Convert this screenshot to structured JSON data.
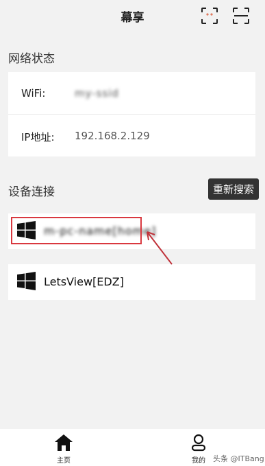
{
  "header": {
    "title": "幕享"
  },
  "network": {
    "section_title": "网络状态",
    "wifi_label": "WiFi:",
    "wifi_value": "my-ssid",
    "ip_label": "IP地址:",
    "ip_value": "192.168.2.129"
  },
  "devices": {
    "section_title": "设备连接",
    "research_label": "重新搜索",
    "items": [
      {
        "name": "m-pc-name[home]"
      },
      {
        "name": "LetsView[EDZ]"
      }
    ]
  },
  "tabbar": {
    "home_label": "主页",
    "mine_label": "我的"
  },
  "watermark": "头条 @ITBang",
  "colors": {
    "highlight": "#d9383f",
    "button_bg": "#333333",
    "page_bg": "#f2f2f2"
  }
}
